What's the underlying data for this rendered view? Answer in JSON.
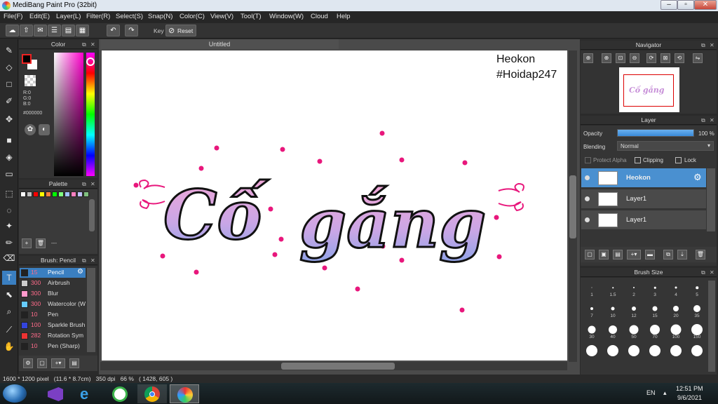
{
  "window": {
    "title": "MediBang Paint Pro (32bit)",
    "min": "–",
    "max": "▫",
    "close": "✕"
  },
  "menu": [
    "File(F)",
    "Edit(E)",
    "Layer(L)",
    "Filter(R)",
    "Select(S)",
    "Snap(N)",
    "Color(C)",
    "View(V)",
    "Tool(T)",
    "Window(W)",
    "Cloud",
    "Help"
  ],
  "toolbar": {
    "key_label": "Key",
    "reset_label": "Reset"
  },
  "color_panel": {
    "title": "Color",
    "r": "R:0",
    "g": "G:0",
    "b": "B:0",
    "hex": "#000000",
    "fg": "#000000",
    "bg": "#ffffff"
  },
  "palette_panel": {
    "title": "Palette",
    "colors": [
      "#ffffff",
      "#c0c0c0",
      "#ff0000",
      "#ffff00",
      "#ff8040",
      "#00ff00",
      "#80ff80",
      "#a0c0ff",
      "#ff80c0",
      "#c0c0ff",
      "#80c080"
    ],
    "dash": "---"
  },
  "brush_panel": {
    "title": "Brush: Pencil",
    "items": [
      {
        "size": "15",
        "name": "Pencil",
        "color": "#222222"
      },
      {
        "size": "300",
        "name": "Airbrush",
        "color": "#cccccc"
      },
      {
        "size": "300",
        "name": "Blur",
        "color": "#ff99cc"
      },
      {
        "size": "300",
        "name": "Watercolor (W",
        "color": "#66ccff"
      },
      {
        "size": "10",
        "name": "Pen",
        "color": "#222222"
      },
      {
        "size": "100",
        "name": "Sparkle Brush",
        "color": "#3344dd"
      },
      {
        "size": "282",
        "name": "Rotation Sym",
        "color": "#ee3333"
      },
      {
        "size": "10",
        "name": "Pen (Sharp)",
        "color": "#222222"
      }
    ]
  },
  "canvas": {
    "tab": "Untitled",
    "watermark_line1": "Heokon",
    "watermark_line2": "#Hoidap247",
    "text_word1": "Cố",
    "text_word2": "gắng"
  },
  "navigator": {
    "title": "Navigator",
    "thumb_text": "Cố gắng"
  },
  "layer_panel": {
    "title": "Layer",
    "opacity_label": "Opacity",
    "opacity_value": "100 %",
    "opacity_fraction": 1.0,
    "blending_label": "Blending",
    "blending_value": "Normal",
    "protect_alpha": "Protect Alpha",
    "clipping": "Clipping",
    "lock": "Lock",
    "layers": [
      {
        "name": "Heokon",
        "selected": true
      },
      {
        "name": "Layer1",
        "selected": false
      },
      {
        "name": "Layer1",
        "selected": false
      }
    ]
  },
  "brush_size": {
    "title": "Brush Size",
    "sizes": [
      "1",
      "1.5",
      "2",
      "3",
      "4",
      "5",
      "7",
      "10",
      "12",
      "15",
      "20",
      "35",
      "30",
      "40",
      "50",
      "70",
      "100",
      "150",
      "",
      "",
      "",
      "",
      "",
      ""
    ]
  },
  "status": {
    "text": "1600 * 1200 pixel   (11.6 * 8.7cm)   350 dpi   66 %   ( 1428, 605 )"
  },
  "taskbar": {
    "lang": "EN",
    "time": "12:51 PM",
    "date": "9/6/2021"
  }
}
